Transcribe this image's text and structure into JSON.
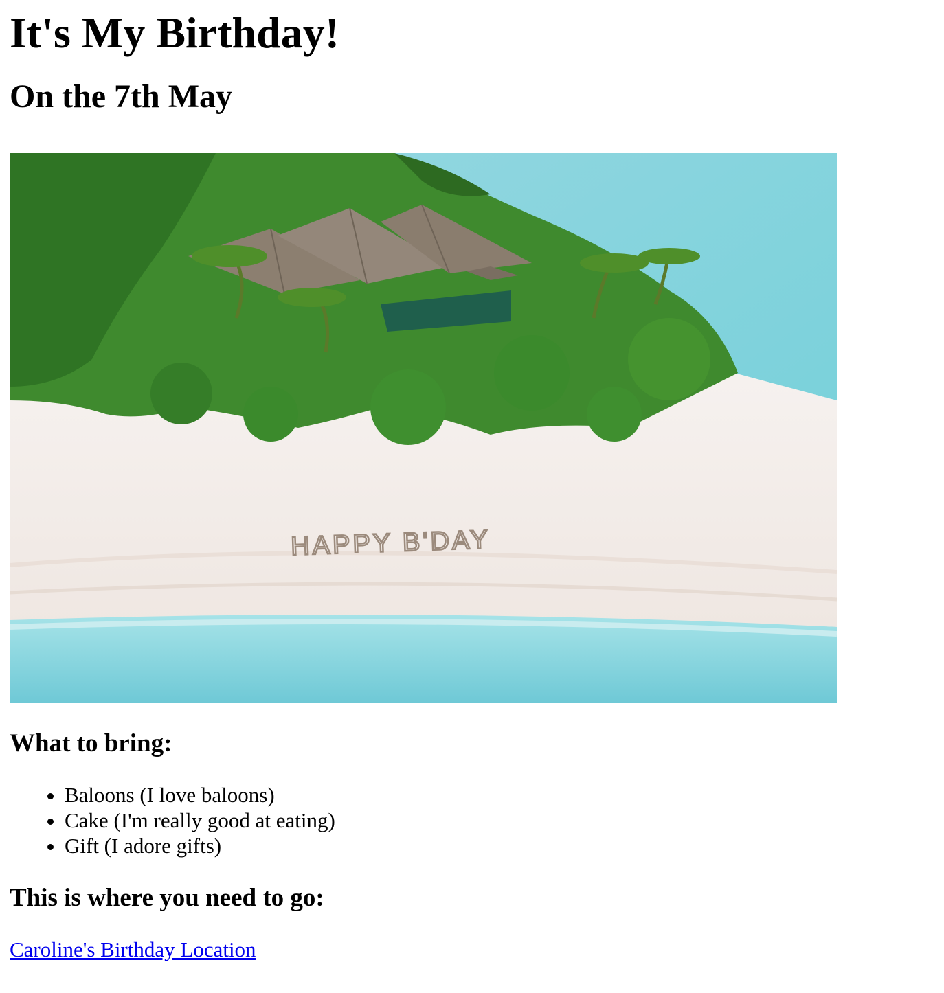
{
  "page": {
    "title": "It's My Birthday!",
    "subtitle": "On the 7th May"
  },
  "hero_image": {
    "icon": "beach-island-image",
    "sand_text": "HAPPY B'DAY",
    "colors": {
      "sea": "#7fd3dc",
      "sand": "#f4efeb",
      "foliage": "#3f8a2e",
      "roof": "#8c7f70"
    }
  },
  "bring": {
    "heading": "What to bring:",
    "items": [
      "Baloons (I love baloons)",
      "Cake (I'm really good at eating)",
      "Gift (I adore gifts)"
    ]
  },
  "location": {
    "heading": "This is where you need to go:",
    "link_text": "Caroline's Birthday Location",
    "link_color": "#0000ee"
  }
}
